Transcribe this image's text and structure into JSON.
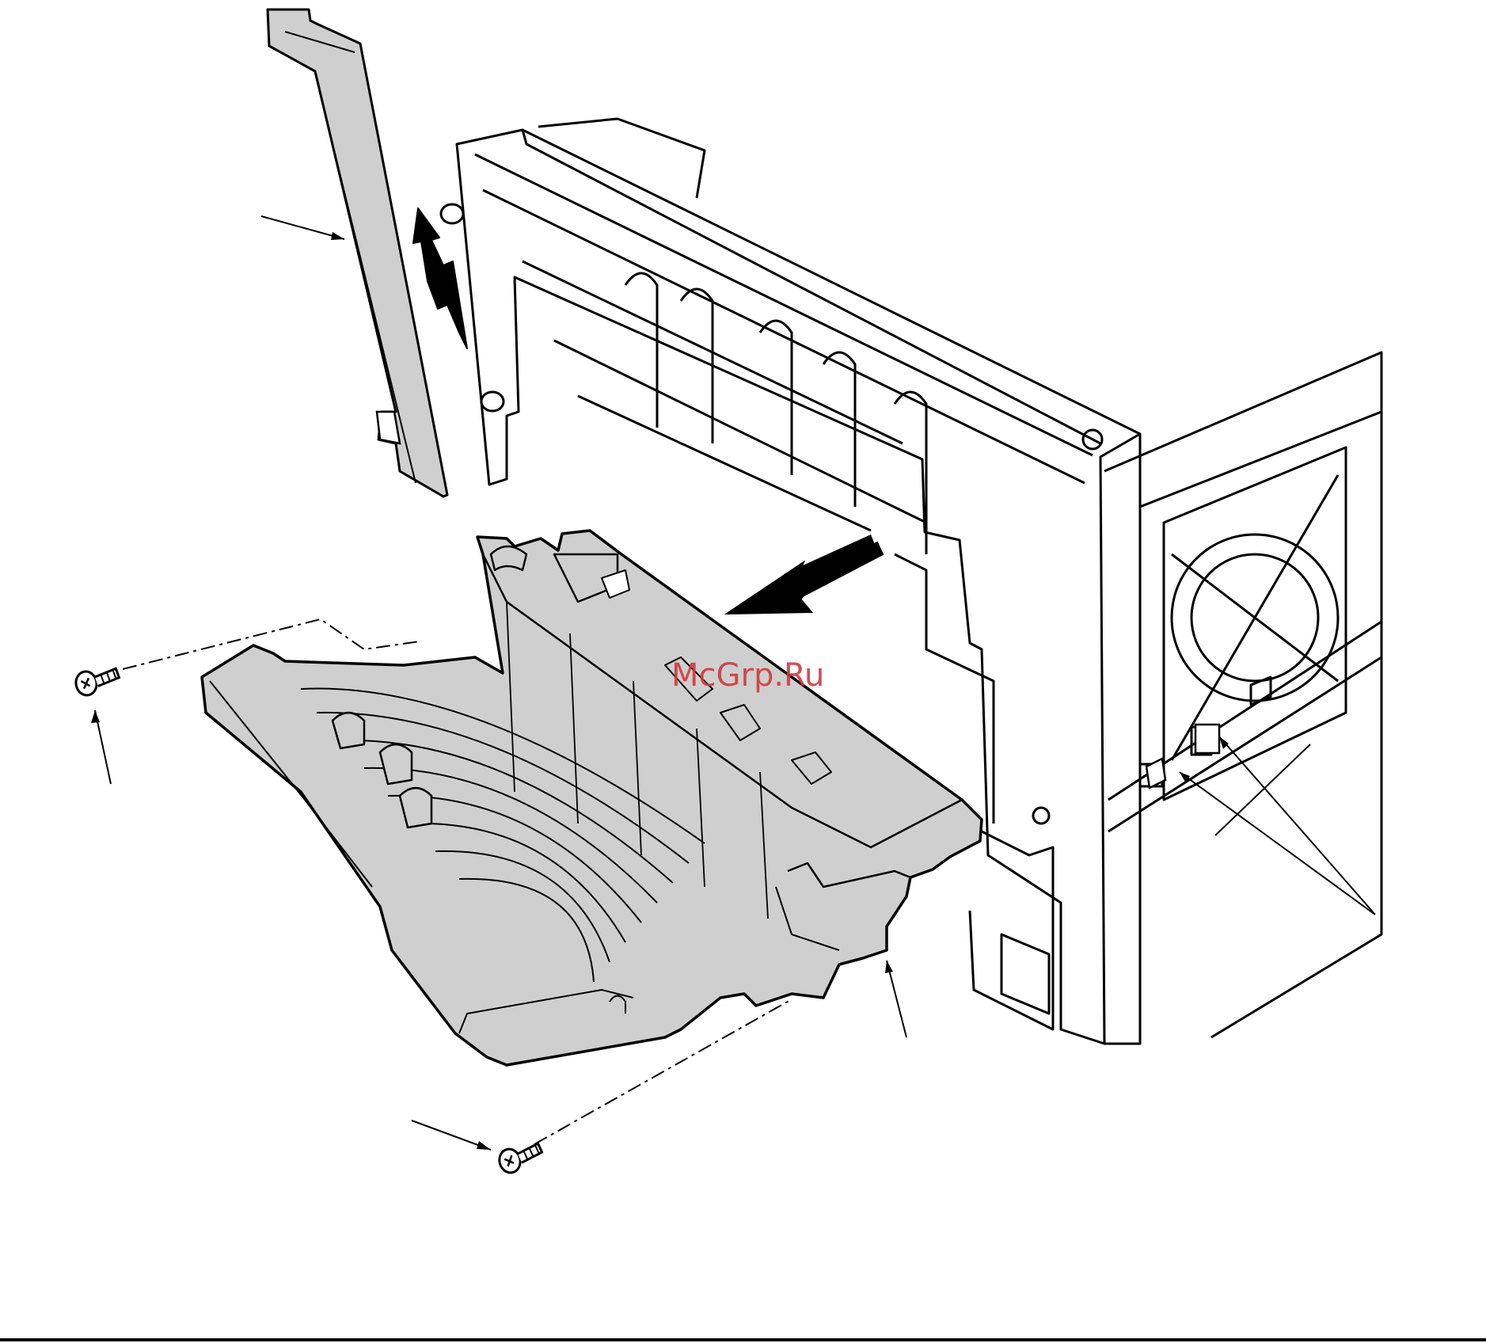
{
  "watermark": "McGrp.Ru",
  "colors": {
    "part_fill": "#cfcfcf",
    "line": "#000000",
    "watermark": "#d0393c"
  },
  "icons": [
    "up-arrow-icon",
    "left-arrow-icon",
    "screw-icon"
  ]
}
